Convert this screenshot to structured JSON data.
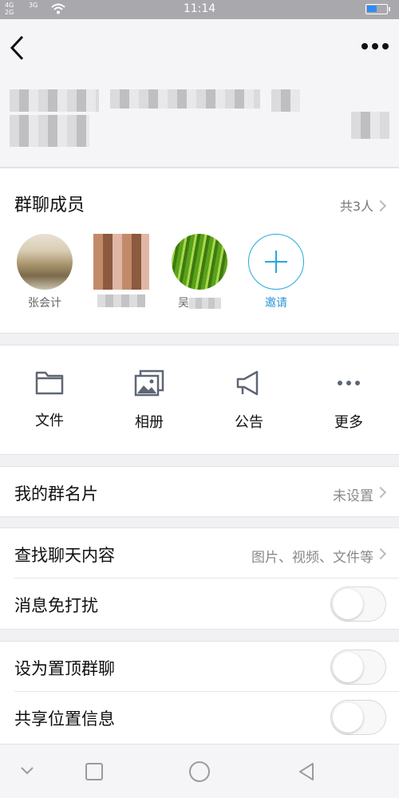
{
  "status_bar": {
    "signal_left": "4G",
    "signal_left2": "2G",
    "signal_right": "3G",
    "time": "11:14",
    "battery_color": "#2e8cf0"
  },
  "top_bar": {
    "back_icon": "chevron-left-icon",
    "more_icon": "more-dots-icon"
  },
  "members": {
    "title": "群聊成员",
    "count_text": "共3人",
    "list": [
      {
        "name": "张会计",
        "avatar": "office-photo"
      },
      {
        "name": "",
        "avatar": "pixelated-photo"
      },
      {
        "name": "吴",
        "avatar": "grass-photo"
      }
    ],
    "invite_label": "邀请",
    "accent_color": "#25a8e0"
  },
  "tools": [
    {
      "label": "文件",
      "icon": "folder-icon"
    },
    {
      "label": "相册",
      "icon": "album-icon"
    },
    {
      "label": "公告",
      "icon": "megaphone-icon"
    },
    {
      "label": "更多",
      "icon": "more-horizontal-icon"
    }
  ],
  "settings": {
    "group_card": {
      "title": "我的群名片",
      "value": "未设置"
    },
    "search_chat": {
      "title": "查找聊天内容",
      "value": "图片、视频、文件等"
    },
    "mute": {
      "title": "消息免打扰",
      "enabled": false
    },
    "pin": {
      "title": "设为置顶群聊",
      "enabled": false
    },
    "share_location": {
      "title": "共享位置信息",
      "enabled": false
    }
  },
  "nav_bar": {
    "icons": [
      "chevron-down-icon",
      "recent-apps-icon",
      "home-icon",
      "back-triangle-icon"
    ]
  }
}
